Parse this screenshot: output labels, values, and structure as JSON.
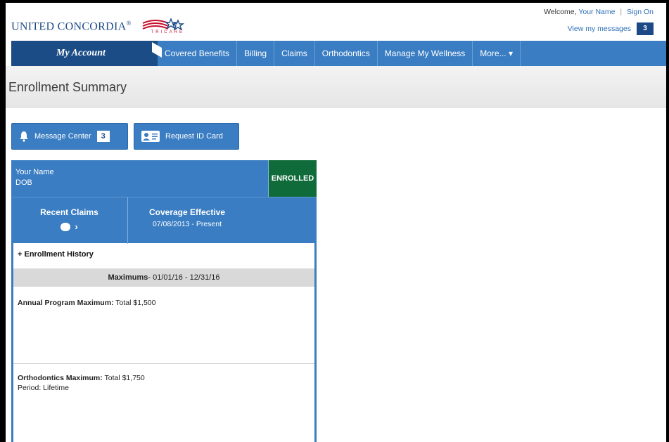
{
  "header": {
    "brand": "UNITED CONCORDIA",
    "brand_reg": "®",
    "tricare": "TRICARE",
    "welcome": "Welcome,",
    "user_name": "Your Name",
    "sign_on": "Sign On",
    "view_messages": "View my messages",
    "message_count": "3"
  },
  "nav": {
    "my_account": "My Account",
    "items": [
      "Covered Benefits",
      "Billing",
      "Claims",
      "Orthodontics",
      "Manage My Wellness",
      "More... ▾"
    ]
  },
  "page": {
    "title": "Enrollment Summary"
  },
  "actions": {
    "message_center": "Message Center",
    "message_center_count": "3",
    "request_id_card": "Request ID Card"
  },
  "card": {
    "name": "Your Name",
    "dob": "DOB",
    "status": "ENROLLED",
    "recent_claims": "Recent Claims",
    "coverage_label": "Coverage Effective",
    "coverage_date": "07/08/2013 - Present",
    "history": "Enrollment History",
    "maximums_label": "Maximums",
    "maximums_range": " - 01/01/16 - 12/31/16",
    "annual_label": "Annual Program Maximum:",
    "annual_value": "Total $1,500",
    "ortho_label": "Orthodontics Maximum:",
    "ortho_value": "Total $1,750",
    "ortho_period": "Period: Lifetime"
  },
  "colors": {
    "nav_blue": "#3a7dc2",
    "account_dark": "#1b4c86",
    "enrolled_green": "#0f6b3a"
  }
}
